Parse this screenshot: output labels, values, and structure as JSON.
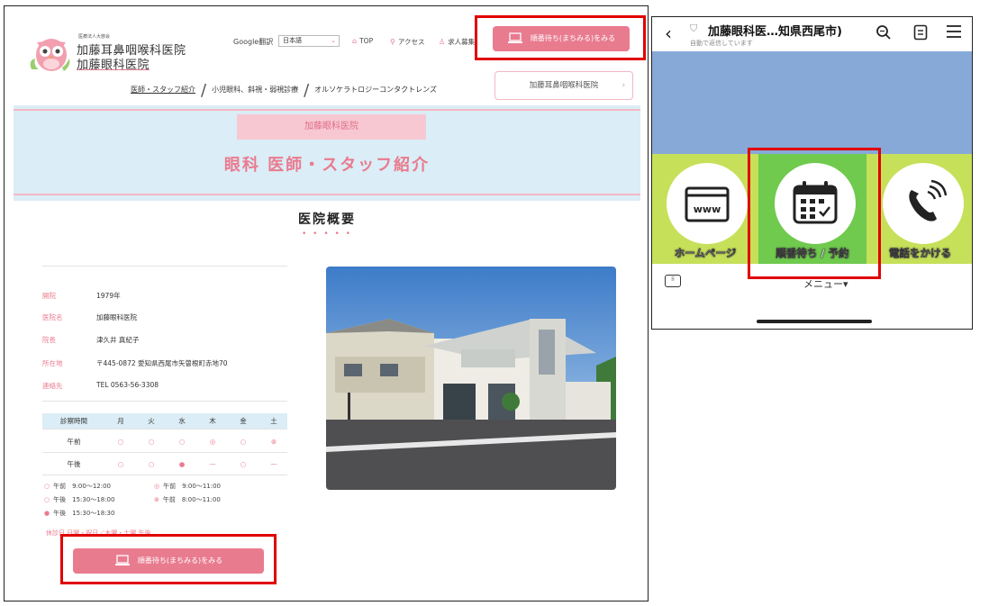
{
  "website": {
    "logo": {
      "subtitle": "医療法人大慈会",
      "line1": "加藤耳鼻咽喉科医院",
      "line2": "加藤眼科医院"
    },
    "google_translate_label": "Google翻訳",
    "language_select": "日本語",
    "topnav": [
      {
        "label": "TOP",
        "icon": "home-icon"
      },
      {
        "label": "アクセス",
        "icon": "location-pin-icon"
      },
      {
        "label": "求人募集",
        "icon": "person-icon"
      }
    ],
    "queue_button_label": "順番待ち(まちみる)をみる",
    "subnav": [
      "医師・スタッフ紹介",
      "小児眼科、斜視・弱視診療",
      "オルソケラトロジーコンタクトレンズ"
    ],
    "ent_button_label": "加藤耳鼻咽喉科医院",
    "banner": {
      "pill": "加藤眼科医院",
      "title": "眼科 医師・スタッフ紹介"
    },
    "section_title": "医院概要",
    "section_dots": "• • • • •",
    "info": [
      {
        "key": "開院",
        "value": "1979年"
      },
      {
        "key": "医院名",
        "value": "加藤眼科医院"
      },
      {
        "key": "院長",
        "value": "津久井 真紀子"
      },
      {
        "key": "所在地",
        "value": "〒445-0872 愛知県西尾市矢曽根町赤地70"
      },
      {
        "key": "連絡先",
        "value": "TEL 0563-56-3308"
      }
    ],
    "hours": {
      "header": [
        "診察時間",
        "月",
        "火",
        "水",
        "木",
        "金",
        "土"
      ],
      "rows": [
        {
          "label": "午前",
          "marks": [
            "○",
            "○",
            "○",
            "◎",
            "○",
            "⊗"
          ]
        },
        {
          "label": "午後",
          "marks": [
            "○",
            "○",
            "●",
            "—",
            "○",
            "—"
          ]
        }
      ]
    },
    "legend": [
      {
        "mark": "○",
        "text": "午前　9:00〜12:00"
      },
      {
        "mark": "○",
        "text": "午後　15:30〜18:00"
      },
      {
        "mark": "●",
        "text": "午後　15:30〜18:30"
      },
      {
        "mark": "◎",
        "text": "午前　9:00〜11:00"
      },
      {
        "mark": "⊗",
        "text": "午前　8:00〜11:00"
      }
    ],
    "closed_days": "休診日 日曜・祝日／木曜・土曜 午後",
    "queue_button_label_2": "順番待ち(まちみる)をみる"
  },
  "phone": {
    "title": "加藤眼科医…知県西尾市)",
    "subtitle": "自動で返信しています",
    "menu_items": [
      {
        "label": "ホームページ",
        "icon": "www-browser-icon"
      },
      {
        "label": "順番待ち / 予約",
        "icon": "calendar-icon"
      },
      {
        "label": "電話をかける",
        "icon": "phone-icon"
      }
    ],
    "menu_toggle": "メニュー▾"
  },
  "colors": {
    "accent_pink": "#e97b8f",
    "banner_blue": "#dbedf6",
    "highlight_red": "#e00000",
    "line_green": "#6fca4d",
    "line_lime": "#c6e05a",
    "sky_blue": "#87a9d8"
  }
}
